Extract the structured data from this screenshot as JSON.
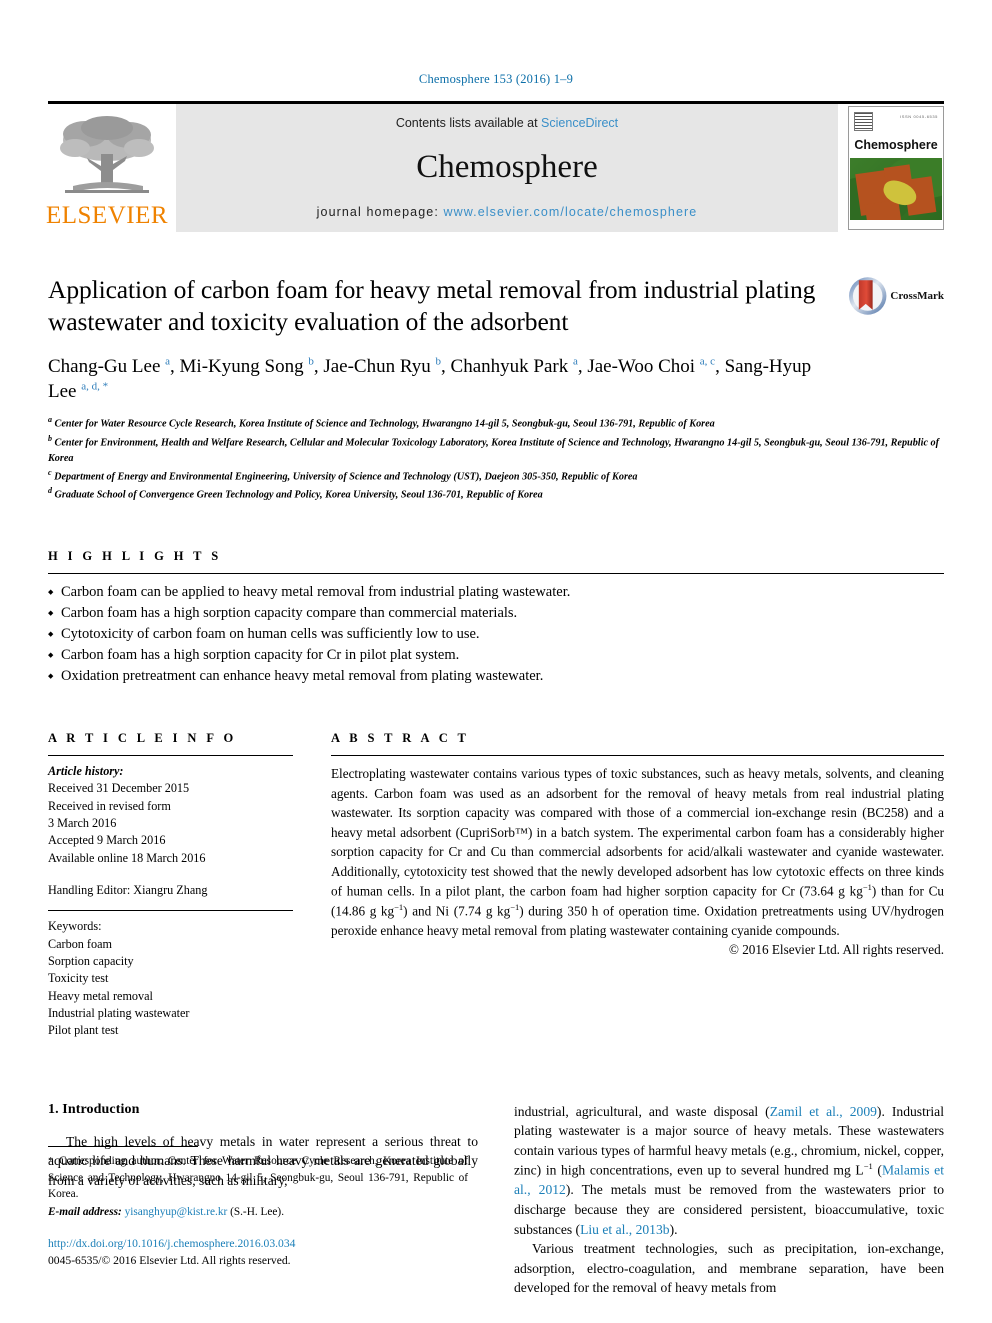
{
  "running_head": "Chemosphere 153 (2016) 1–9",
  "masthead": {
    "publisher_name": "ELSEVIER",
    "contents_prefix": "Contents lists available at ",
    "sciencedirect": "ScienceDirect",
    "journal_name": "Chemosphere",
    "homepage_prefix": "journal homepage: ",
    "homepage_url": "www.elsevier.com/locate/chemosphere",
    "cover_title": "Chemosphere",
    "cover_tiny_text": "ISSN 0045-6535"
  },
  "article": {
    "title": "Application of carbon foam for heavy metal removal from industrial plating wastewater and toxicity evaluation of the adsorbent",
    "crossmark_label": "CrossMark",
    "authors_html": "Chang-Gu Lee <sup>a</sup>, Mi-Kyung Song <sup>b</sup>, Jae-Chun Ryu <sup>b</sup>, Chanhyuk Park <sup>a</sup>, Jae-Woo Choi <sup>a, c</sup>, Sang-Hyup Lee <sup>a, d, *</sup>",
    "affiliations": [
      "<sup>a</sup> Center for Water Resource Cycle Research, Korea Institute of Science and Technology, Hwarangno 14-gil 5, Seongbuk-gu, Seoul 136-791, Republic of Korea",
      "<sup>b</sup> Center for Environment, Health and Welfare Research, Cellular and Molecular Toxicology Laboratory, Korea Institute of Science and Technology, Hwarangno 14-gil 5, Seongbuk-gu, Seoul 136-791, Republic of Korea",
      "<sup>c</sup> Department of Energy and Environmental Engineering, University of Science and Technology (UST), Daejeon 305-350, Republic of Korea",
      "<sup>d</sup> Graduate School of Convergence Green Technology and Policy, Korea University, Seoul 136-701, Republic of Korea"
    ]
  },
  "highlights": {
    "label": "H I G H L I G H T S",
    "items": [
      "Carbon foam can be applied to heavy metal removal from industrial plating wastewater.",
      "Carbon foam has a high sorption capacity compare than commercial materials.",
      "Cytotoxicity of carbon foam on human cells was sufficiently low to use.",
      "Carbon foam has a high sorption capacity for Cr in pilot plat system.",
      "Oxidation pretreatment can enhance heavy metal removal from plating wastewater."
    ]
  },
  "article_info": {
    "label": "A R T I C L E   I N F O",
    "history_label": "Article history:",
    "history_lines": [
      "Received 31 December 2015",
      "Received in revised form",
      "3 March 2016",
      "Accepted 9 March 2016",
      "Available online 18 March 2016"
    ],
    "handling_editor": "Handling Editor: Xiangru Zhang",
    "keywords_label": "Keywords:",
    "keywords": [
      "Carbon foam",
      "Sorption capacity",
      "Toxicity test",
      "Heavy metal removal",
      "Industrial plating wastewater",
      "Pilot plant test"
    ]
  },
  "abstract": {
    "label": "A B S T R A C T",
    "text_html": "Electroplating wastewater contains various types of toxic substances, such as heavy metals, solvents, and cleaning agents. Carbon foam was used as an adsorbent for the removal of heavy metals from real industrial plating wastewater. Its sorption capacity was compared with those of a commercial ion-exchange resin (BC258) and a heavy metal adsorbent (CupriSorb™) in a batch system. The experimental carbon foam has a considerably higher sorption capacity for Cr and Cu than commercial adsorbents for acid/alkali wastewater and cyanide wastewater. Additionally, cytotoxicity test showed that the newly developed adsorbent has low cytotoxic effects on three kinds of human cells. In a pilot plant, the carbon foam had higher sorption capacity for Cr (73.64 g kg<sup class=\"sup-small\">−1</sup>) than for Cu (14.86 g kg<sup class=\"sup-small\">−1</sup>) and Ni (7.74 g kg<sup class=\"sup-small\">−1</sup>) during 350 h of operation time. Oxidation pretreatments using UV/hydrogen peroxide enhance heavy metal removal from plating wastewater containing cyanide compounds.",
    "copyright": "© 2016 Elsevier Ltd. All rights reserved."
  },
  "body": {
    "section_heading": "1. Introduction",
    "left_paragraph_html": "The high levels of heavy metals in water represent a serious threat to aquatic life and humans. These harmful heavy metals are generated globally from a variety of activities, such as military,",
    "right_paragraph_1_html": "industrial, agricultural, and waste disposal (<span class=\"ref\">Zamil et al., 2009</span>). Industrial plating wastewater is a major source of heavy metals. These wastewaters contain various types of harmful heavy metals (e.g., chromium, nickel, copper, zinc) in high concentrations, even up to several hundred mg L<sup class=\"sup-small\">−1</sup> (<span class=\"ref\">Malamis et al., 2012</span>). The metals must be removed from the wastewaters prior to discharge because they are considered persistent, bioaccumulative, toxic substances (<span class=\"ref\">Liu et al., 2013b</span>).",
    "right_paragraph_2_html": "Various treatment technologies, such as precipitation, ion-exchange, adsorption, electro-coagulation, and membrane separation, have been developed for the removal of heavy metals from"
  },
  "footnotes": {
    "corresponding_html": "<span class=\"star\">*</span> Corresponding author. Center for Water Resource Cycle Research, Korea Institute of Science and Technology, Hwarangno 14-gil 5, Seongbuk-gu, Seoul 136-791, Republic of Korea.",
    "email_label": "E-mail address:",
    "email": "yisanghyup@kist.re.kr",
    "email_suffix": "(S.-H. Lee).",
    "doi_url": "http://dx.doi.org/10.1016/j.chemosphere.2016.03.034",
    "issn_line": "0045-6535/© 2016 Elsevier Ltd. All rights reserved."
  },
  "colors": {
    "link_blue": "#1b7fb8",
    "header_blue": "#0b6ea8",
    "sciencedirect_blue": "#3a8fc8",
    "elsevier_orange": "#ef8200",
    "masthead_grey": "#e6e6e6"
  }
}
